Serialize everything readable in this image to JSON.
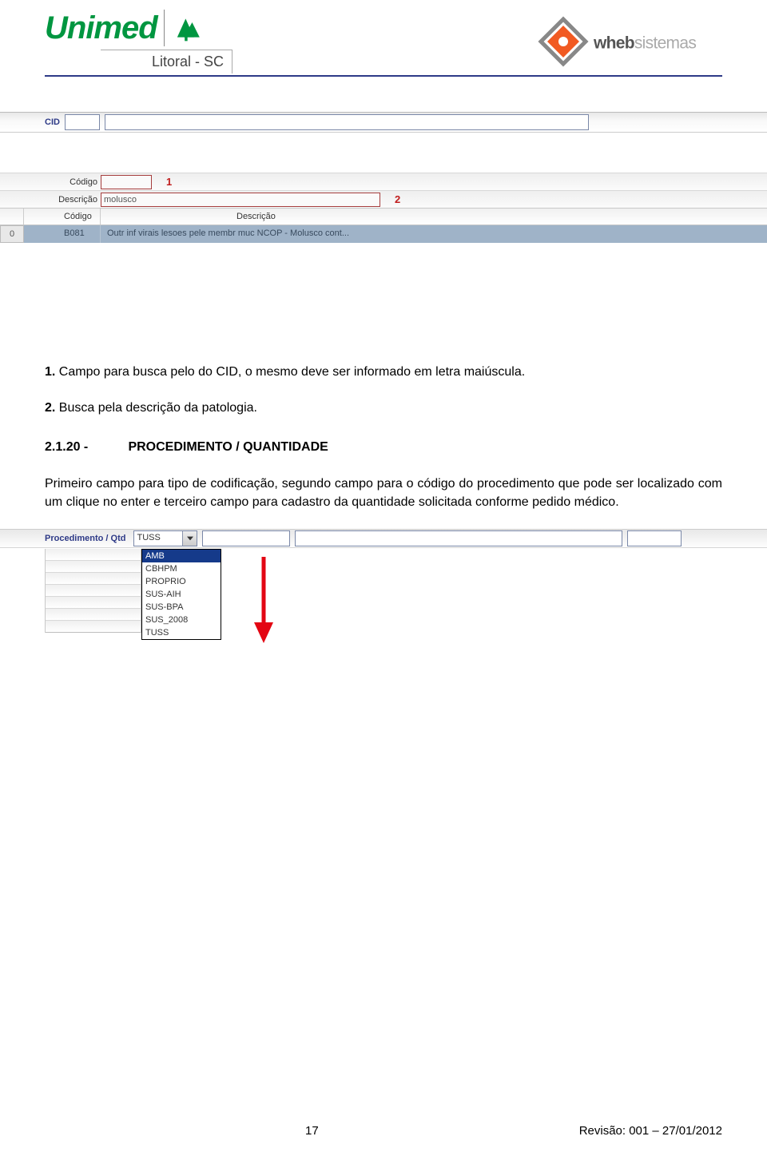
{
  "header": {
    "unimed_word": "Unimed",
    "litoral": "Litoral - SC",
    "wheb_bold": "wheb",
    "wheb_light": "sistemas"
  },
  "cid_bar": {
    "label": "CID",
    "code_value": "",
    "desc_value": ""
  },
  "cid_search": {
    "codigo_label": "Código",
    "codigo_value": "",
    "ann1": "1",
    "desc_label": "Descrição",
    "desc_value": "molusco",
    "ann2": "2",
    "th_codigo": "Código",
    "th_desc": "Descrição",
    "row_idx": "0",
    "row_code": "B081",
    "row_desc": "Outr inf virais lesoes pele membr muc NCOP - Molusco cont..."
  },
  "text": {
    "p1_num": "1.",
    "p1": "Campo para busca pelo do CID, o mesmo deve ser informado em letra maiúscula.",
    "p2_num": "2.",
    "p2": "Busca pela descrição da patologia.",
    "hnum": "2.1.20 -",
    "htitle": "PROCEDIMENTO / QUANTIDADE",
    "p3": "Primeiro campo para tipo de codificação, segundo campo para o código do procedimento que pode ser localizado com um clique no enter e terceiro campo para cadastro da quantidade solicitada conforme pedido médico."
  },
  "proc": {
    "label": "Procedimento / Qtd",
    "selected": "TUSS",
    "options": [
      "AMB",
      "CBHPM",
      "PROPRIO",
      "SUS-AIH",
      "SUS-BPA",
      "SUS_2008",
      "TUSS"
    ]
  },
  "footer": {
    "page": "17",
    "rev": "Revisão: 001 – 27/01/2012"
  }
}
